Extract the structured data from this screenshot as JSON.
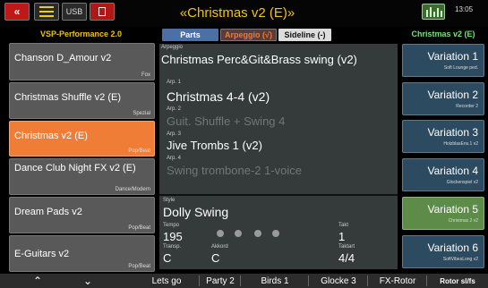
{
  "header": {
    "title": "«Christmas v2 (E)»",
    "clock": "13:05",
    "usb_label": "USB",
    "back_icon": "double-chevron-left-icon"
  },
  "left_header": "VSP-Performance 2.0",
  "tabs": [
    {
      "label": "Parts"
    },
    {
      "label": "Arpeggio (√)"
    },
    {
      "label": "Sideline (-)"
    }
  ],
  "right_header": "Christmas v2 (E)",
  "songs": [
    {
      "name": "Chanson D_Amour v2",
      "category": "Fox"
    },
    {
      "name": "Christmas Shuffle v2 (E)",
      "category": "Spezial"
    },
    {
      "name": "Christmas v2 (E)",
      "category": "Pop/Beat"
    },
    {
      "name": "Dance Club Night FX v2 (E)",
      "category": "Dance/Modern"
    },
    {
      "name": "Dream Pads v2",
      "category": "Pop/Beat"
    },
    {
      "name": "E-Guitars v2",
      "category": "Pop/Beat"
    }
  ],
  "arpeggio": {
    "label": "Arpeggio",
    "name": "Christmas Perc&Git&Brass swing (v2)",
    "arps": [
      {
        "label": "Arp. 1",
        "value": "Christmas 4-4 (v2)",
        "active": true
      },
      {
        "label": "Arp. 2",
        "value": "Guit. Shuffle + Swing 4",
        "active": false
      },
      {
        "label": "Arp. 3",
        "value": "Jive Trombs 1 (v2)",
        "active": true
      },
      {
        "label": "Arp. 4",
        "value": "Swing trombone-2 1-voice",
        "active": false
      }
    ]
  },
  "style": {
    "label": "Style",
    "name": "Dolly Swing",
    "tempo_label": "Tempo",
    "tempo": "195",
    "takt_label": "Takt",
    "takt": "1",
    "transp_label": "Transp.",
    "transp": "C",
    "akkord_label": "Akkord",
    "akkord": "C",
    "taktart_label": "Taktart",
    "taktart": "4/4"
  },
  "variations": [
    {
      "name": "Variation 1",
      "sub": "Soft Lounge ped.",
      "active": false
    },
    {
      "name": "Variation 2",
      "sub": "Recorder 2",
      "active": false
    },
    {
      "name": "Variation 3",
      "sub": "HolzblasEns.1 v2",
      "active": false
    },
    {
      "name": "Variation 4",
      "sub": "Glockenspiel v2",
      "active": false
    },
    {
      "name": "Variation 5",
      "sub": "Christmas 2 v2",
      "active": true
    },
    {
      "name": "Variation 6",
      "sub": "SoftVibesLong v2",
      "active": false
    }
  ],
  "bottom": {
    "up_arrow": "⌃",
    "down_arrow": "⌄",
    "buttons": [
      "Lets go",
      "Party 2",
      "Birds 1",
      "Glocke 3",
      "FX-Rotor",
      "Rotor sl/fs"
    ]
  }
}
